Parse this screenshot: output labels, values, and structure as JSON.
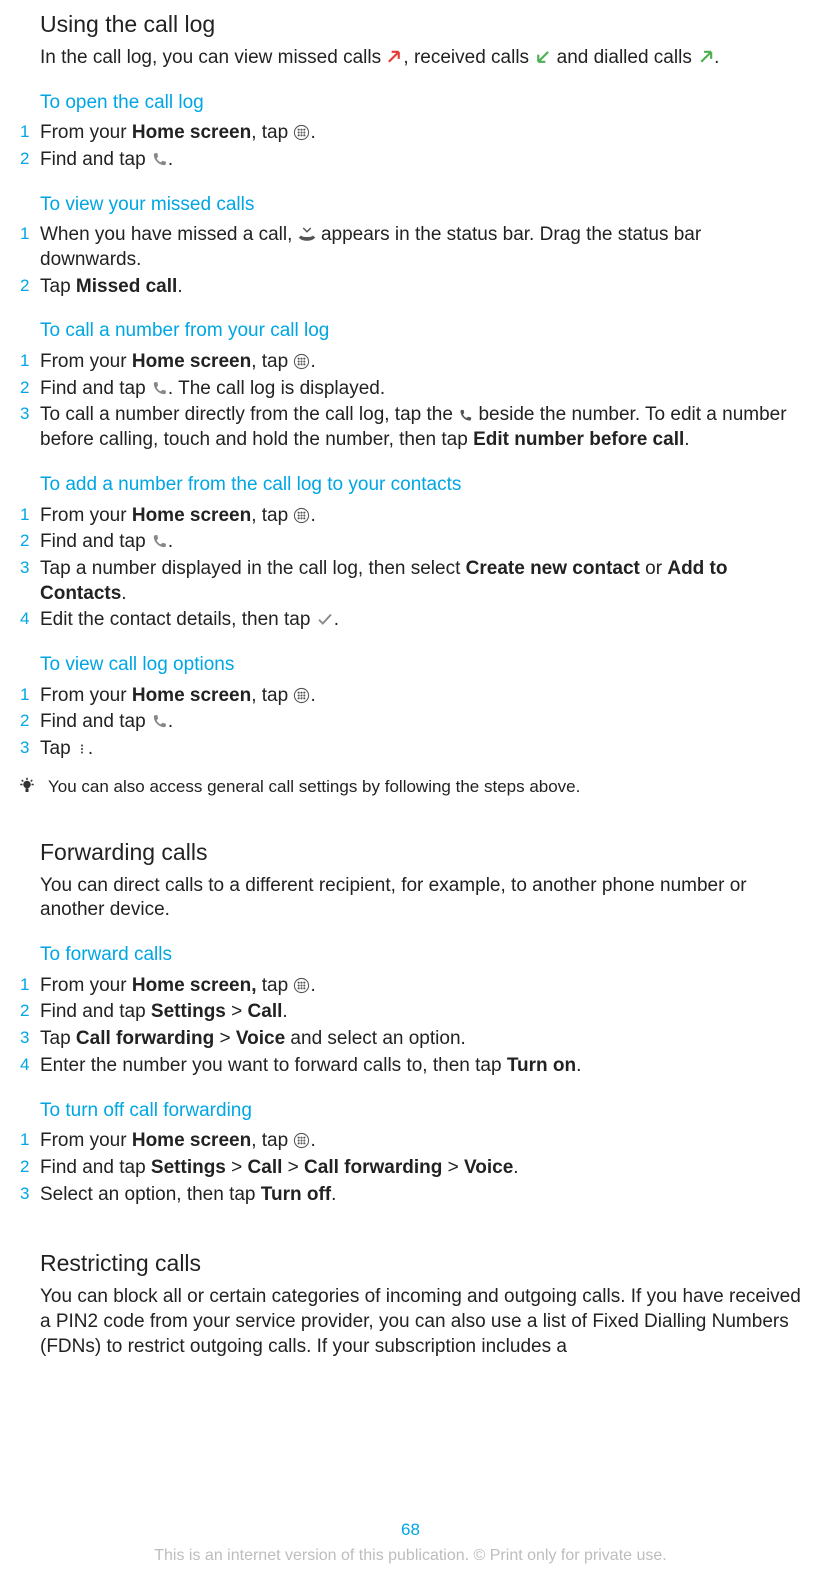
{
  "section1": {
    "title": "Using the call log",
    "intro_parts": {
      "a": "In the call log, you can view missed calls ",
      "b": ", received calls ",
      "c": " and dialled calls ",
      "d": "."
    }
  },
  "sub_open": {
    "heading": "To open the call log",
    "s1a": "From your ",
    "s1b": "Home screen",
    "s1c": ", tap ",
    "s1d": ".",
    "s2a": "Find and tap ",
    "s2b": "."
  },
  "sub_missed": {
    "heading": "To view your missed calls",
    "s1a": "When you have missed a call, ",
    "s1b": " appears in the status bar. Drag the status bar downwards.",
    "s2a": "Tap ",
    "s2b": "Missed call",
    "s2c": "."
  },
  "sub_callnum": {
    "heading": "To call a number from your call log",
    "s1a": "From your ",
    "s1b": "Home screen",
    "s1c": ", tap ",
    "s1d": ".",
    "s2a": "Find and tap ",
    "s2b": ". The call log is displayed.",
    "s3a": "To call a number directly from the call log, tap the ",
    "s3b": " beside the number. To edit a number before calling, touch and hold the number, then tap ",
    "s3c": "Edit number before call",
    "s3d": "."
  },
  "sub_add": {
    "heading": "To add a number from the call log to your contacts",
    "s1a": "From your ",
    "s1b": "Home screen",
    "s1c": ", tap ",
    "s1d": ".",
    "s2a": "Find and tap ",
    "s2b": ".",
    "s3a": "Tap a number displayed in the call log, then select ",
    "s3b": "Create new contact",
    "s3c": " or ",
    "s3d": "Add to Contacts",
    "s3e": ".",
    "s4a": "Edit the contact details, then tap ",
    "s4b": "."
  },
  "sub_opts": {
    "heading": "To view call log options",
    "s1a": "From your ",
    "s1b": "Home screen",
    "s1c": ", tap ",
    "s1d": ".",
    "s2a": "Find and tap ",
    "s2b": ".",
    "s3a": "Tap ",
    "s3b": "."
  },
  "tip": "You can also access general call settings by following the steps above.",
  "section2": {
    "title": "Forwarding calls",
    "intro": "You can direct calls to a different recipient, for example, to another phone number or another device."
  },
  "sub_fwd": {
    "heading": "To forward calls",
    "s1a": "From your ",
    "s1b": "Home screen,",
    "s1c": " tap ",
    "s1d": ".",
    "s2a": "Find and tap ",
    "s2b": "Settings",
    "s2c": " > ",
    "s2d": "Call",
    "s2e": ".",
    "s3a": "Tap ",
    "s3b": "Call forwarding",
    "s3c": " > ",
    "s3d": "Voice",
    "s3e": " and select an option.",
    "s4a": "Enter the number you want to forward calls to, then tap ",
    "s4b": "Turn on",
    "s4c": "."
  },
  "sub_fwdoff": {
    "heading": "To turn off call forwarding",
    "s1a": "From your ",
    "s1b": "Home screen",
    "s1c": ", tap ",
    "s1d": ".",
    "s2a": "Find and tap ",
    "s2b": "Settings",
    "s2c": " > ",
    "s2d": "Call",
    "s2e": " > ",
    "s2f": "Call forwarding",
    "s2g": " > ",
    "s2h": "Voice",
    "s2i": ".",
    "s3a": "Select an option, then tap ",
    "s3b": "Turn off",
    "s3c": "."
  },
  "section3": {
    "title": "Restricting calls",
    "intro": "You can block all or certain categories of incoming and outgoing calls. If you have received a PIN2 code from your service provider, you can also use a list of Fixed Dialling Numbers (FDNs) to restrict outgoing calls. If your subscription includes a"
  },
  "page_num": "68",
  "footer": "This is an internet version of this publication. © Print only for private use."
}
